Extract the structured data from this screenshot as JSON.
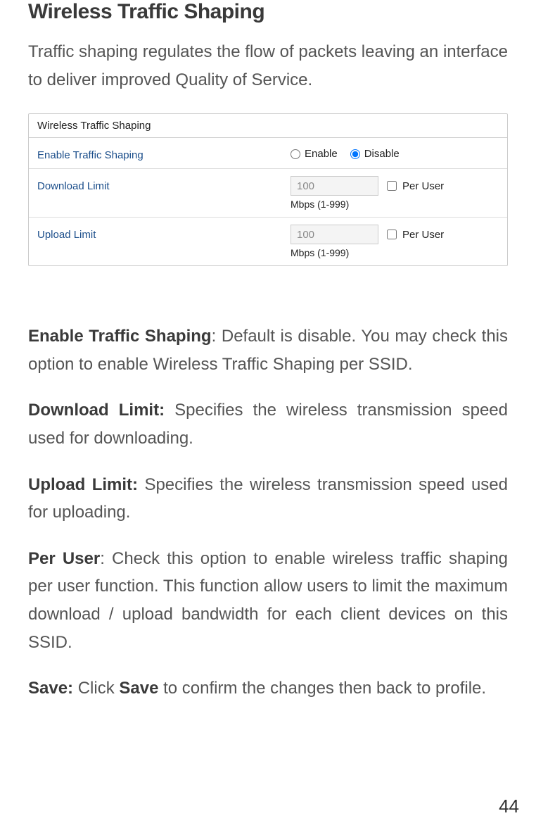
{
  "title": "Wireless Traffic Shaping",
  "intro": "Traffic shaping regulates the flow of packets leaving an interface to deliver improved Quality of Service.",
  "panel": {
    "header": "Wireless Traffic Shaping",
    "enable_label": "Enable Traffic Shaping",
    "enable_option": "Enable",
    "disable_option": "Disable",
    "download_label": "Download Limit",
    "upload_label": "Upload Limit",
    "input_value": "100",
    "hint": "Mbps (1-999)",
    "per_user_label": "Per User"
  },
  "defs": {
    "enable_term": "Enable Traffic Shaping",
    "enable_text": ": Default is disable. You may check this option to enable Wireless Traffic Shaping per SSID.",
    "download_term": "Download Limit:",
    "download_text": " Specifies the wireless transmission speed used for downloading.",
    "upload_term": "Upload Limit:",
    "upload_text": " Specifies the wireless transmission speed used for uploading.",
    "peruser_term": "Per User",
    "peruser_text": ": Check this option to enable wireless traffic shaping per user function. This function allow users to limit the maximum download / upload bandwidth for each client devices on this SSID.",
    "save_term": "Save:",
    "save_text_pre": " Click ",
    "save_word": "Save",
    "save_text_post": " to confirm the changes then back to profile."
  },
  "page_number": "44"
}
